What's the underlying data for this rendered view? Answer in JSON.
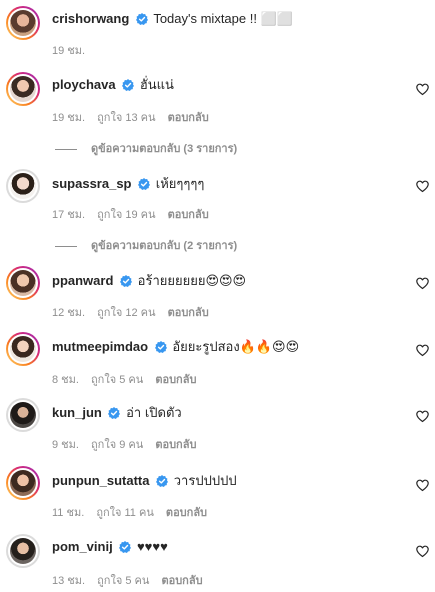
{
  "caption": {
    "username": "crishorwang",
    "text": "Today's mixtape !! ⬜⬜",
    "time": "19 ชม."
  },
  "comments": [
    {
      "username": "ploychava",
      "text": "ฮั่นแน่",
      "time": "19 ชม.",
      "likes": "ถูกใจ 13 คน",
      "reply": "ตอบกลับ",
      "view_replies": "ดูข้อความตอบกลับ (3 รายการ)"
    },
    {
      "username": "supassra_sp",
      "text": "เห้ยๆๆๆๆ",
      "time": "17 ชม.",
      "likes": "ถูกใจ 19 คน",
      "reply": "ตอบกลับ",
      "view_replies": "ดูข้อความตอบกลับ (2 รายการ)"
    },
    {
      "username": "ppanward",
      "text": "อร้ายยยยยย😍😍😍",
      "time": "12 ชม.",
      "likes": "ถูกใจ 12 คน",
      "reply": "ตอบกลับ"
    },
    {
      "username": "mutmeepimdao",
      "text": "อัยยะรูปสอง🔥🔥😍😍",
      "time": "8 ชม.",
      "likes": "ถูกใจ 5 คน",
      "reply": "ตอบกลับ"
    },
    {
      "username": "kun_jun",
      "text": "อ่า เปิดตัว",
      "time": "9 ชม.",
      "likes": "ถูกใจ 9 คน",
      "reply": "ตอบกลับ"
    },
    {
      "username": "punpun_sutatta",
      "text": "วารปปปปป",
      "time": "11 ชม.",
      "likes": "ถูกใจ 11 คน",
      "reply": "ตอบกลับ"
    },
    {
      "username": "pom_vinij",
      "text": "♥♥♥♥",
      "time": "13 ชม.",
      "likes": "ถูกใจ 5 คน",
      "reply": "ตอบกลับ"
    }
  ],
  "colors": {
    "verified": "#3897f0",
    "muted": "#8e8e8e",
    "story_ring": "#d62976"
  }
}
